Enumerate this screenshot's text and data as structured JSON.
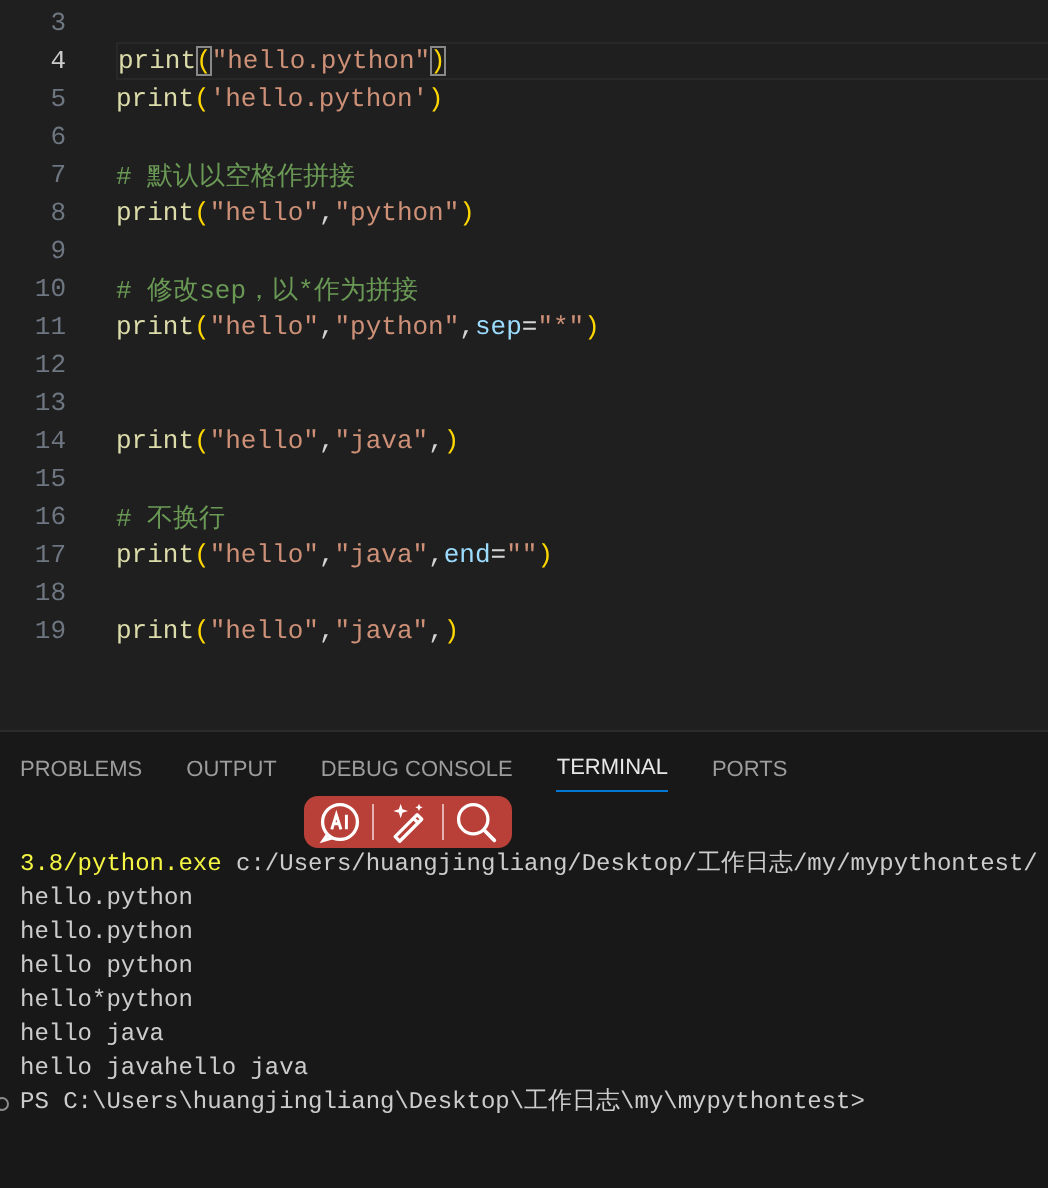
{
  "editor": {
    "lines": [
      {
        "number": "3",
        "current": false
      },
      {
        "number": "4",
        "current": true,
        "tokens": [
          {
            "kind": "func",
            "text": "print"
          },
          {
            "kind": "paren",
            "text": "(",
            "matched": true
          },
          {
            "kind": "string",
            "text": "\"hello.python\""
          },
          {
            "kind": "paren",
            "text": ")",
            "matched": true
          }
        ]
      },
      {
        "number": "5",
        "current": false,
        "tokens": [
          {
            "kind": "func",
            "text": "print"
          },
          {
            "kind": "paren",
            "text": "("
          },
          {
            "kind": "string",
            "text": "'hello.python'"
          },
          {
            "kind": "paren",
            "text": ")"
          }
        ]
      },
      {
        "number": "6",
        "current": false
      },
      {
        "number": "7",
        "current": false,
        "tokens": [
          {
            "kind": "comment",
            "text": "# 默认以空格作拼接"
          }
        ]
      },
      {
        "number": "8",
        "current": false,
        "tokens": [
          {
            "kind": "func",
            "text": "print"
          },
          {
            "kind": "paren",
            "text": "("
          },
          {
            "kind": "string",
            "text": "\"hello\""
          },
          {
            "kind": "punct",
            "text": ","
          },
          {
            "kind": "string",
            "text": "\"python\""
          },
          {
            "kind": "paren",
            "text": ")"
          }
        ]
      },
      {
        "number": "9",
        "current": false
      },
      {
        "number": "10",
        "current": false,
        "tokens": [
          {
            "kind": "comment",
            "text": "# 修改sep，以*作为拼接"
          }
        ]
      },
      {
        "number": "11",
        "current": false,
        "tokens": [
          {
            "kind": "func",
            "text": "print"
          },
          {
            "kind": "paren",
            "text": "("
          },
          {
            "kind": "string",
            "text": "\"hello\""
          },
          {
            "kind": "punct",
            "text": ","
          },
          {
            "kind": "string",
            "text": "\"python\""
          },
          {
            "kind": "punct",
            "text": ","
          },
          {
            "kind": "param",
            "text": "sep"
          },
          {
            "kind": "punct",
            "text": "="
          },
          {
            "kind": "string",
            "text": "\"*\""
          },
          {
            "kind": "paren",
            "text": ")"
          }
        ]
      },
      {
        "number": "12",
        "current": false
      },
      {
        "number": "13",
        "current": false
      },
      {
        "number": "14",
        "current": false,
        "tokens": [
          {
            "kind": "func",
            "text": "print"
          },
          {
            "kind": "paren",
            "text": "("
          },
          {
            "kind": "string",
            "text": "\"hello\""
          },
          {
            "kind": "punct",
            "text": ","
          },
          {
            "kind": "string",
            "text": "\"java\""
          },
          {
            "kind": "punct",
            "text": ","
          },
          {
            "kind": "paren",
            "text": ")"
          }
        ]
      },
      {
        "number": "15",
        "current": false
      },
      {
        "number": "16",
        "current": false,
        "tokens": [
          {
            "kind": "comment",
            "text": "# 不换行"
          }
        ]
      },
      {
        "number": "17",
        "current": false,
        "tokens": [
          {
            "kind": "func",
            "text": "print"
          },
          {
            "kind": "paren",
            "text": "("
          },
          {
            "kind": "string",
            "text": "\"hello\""
          },
          {
            "kind": "punct",
            "text": ","
          },
          {
            "kind": "string",
            "text": "\"java\""
          },
          {
            "kind": "punct",
            "text": ","
          },
          {
            "kind": "param",
            "text": "end"
          },
          {
            "kind": "punct",
            "text": "="
          },
          {
            "kind": "string",
            "text": "\"\""
          },
          {
            "kind": "paren",
            "text": ")"
          }
        ]
      },
      {
        "number": "18",
        "current": false
      },
      {
        "number": "19",
        "current": false,
        "tokens": [
          {
            "kind": "func",
            "text": "print"
          },
          {
            "kind": "paren",
            "text": "("
          },
          {
            "kind": "string",
            "text": "\"hello\""
          },
          {
            "kind": "punct",
            "text": ","
          },
          {
            "kind": "string",
            "text": "\"java\""
          },
          {
            "kind": "punct",
            "text": ","
          },
          {
            "kind": "paren",
            "text": ")"
          }
        ]
      }
    ]
  },
  "panel": {
    "tabs": [
      {
        "label": "PROBLEMS",
        "selected": false
      },
      {
        "label": "OUTPUT",
        "selected": false
      },
      {
        "label": "DEBUG CONSOLE",
        "selected": false
      },
      {
        "label": "TERMINAL",
        "selected": true
      },
      {
        "label": "PORTS",
        "selected": false
      }
    ]
  },
  "floating_toolbar": {
    "buttons": [
      {
        "kind": "ai"
      },
      {
        "kind": "wand"
      },
      {
        "kind": "search"
      }
    ]
  },
  "terminal": {
    "lines": [
      {
        "kind": "command",
        "parts": [
          {
            "kind": "exe",
            "text": "3.8/python.exe"
          },
          {
            "kind": "arg",
            "text": " c:/Users/huangjingliang/Desktop/工作日志/my/mypythontest/"
          }
        ]
      },
      {
        "kind": "output",
        "text": "hello.python"
      },
      {
        "kind": "output",
        "text": "hello.python"
      },
      {
        "kind": "output",
        "text": "hello python"
      },
      {
        "kind": "output",
        "text": "hello*python"
      },
      {
        "kind": "output",
        "text": "hello java"
      },
      {
        "kind": "output",
        "text": "hello javahello java"
      },
      {
        "kind": "prompt",
        "text": "PS C:\\Users\\huangjingliang\\Desktop\\工作日志\\my\\mypythontest>"
      }
    ]
  }
}
